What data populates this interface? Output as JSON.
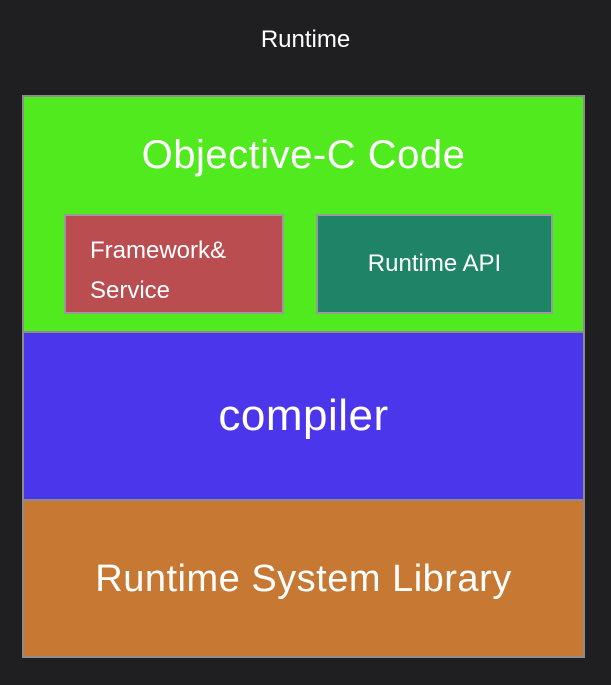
{
  "title": "Runtime",
  "layers": {
    "code": {
      "label": "Objective-C Code",
      "color": "#50ea1f",
      "boxes": {
        "framework": {
          "line1": "Framework&",
          "line2": "Service",
          "color": "#b94d4f"
        },
        "runtime_api": {
          "label": "Runtime API",
          "color": "#1f8368"
        }
      }
    },
    "compiler": {
      "label": "compiler",
      "color": "#4b36eb"
    },
    "library": {
      "label": "Runtime System Library",
      "color": "#c77934"
    }
  }
}
